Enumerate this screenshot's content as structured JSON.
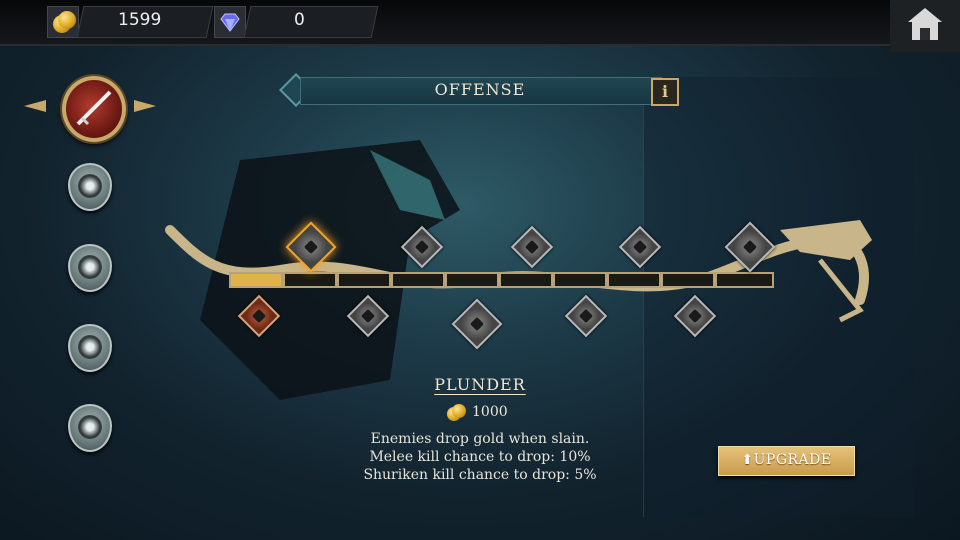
{
  "currency": {
    "gold": "1599",
    "gems": "0"
  },
  "header": {
    "title": "OFFENSE",
    "info_icon": "i"
  },
  "skill": {
    "name": "PLUNDER",
    "cost": "1000",
    "description": [
      "Enemies drop gold when slain.",
      "Melee kill chance to drop: 10%",
      "Shuriken kill chance to drop: 5%"
    ]
  },
  "actions": {
    "upgrade_label": "UPGRADE",
    "upgrade_arrow": "⬆"
  },
  "sidebar": {
    "tabs": [
      "offense",
      "shadow-dash",
      "spirit",
      "magic",
      "stealth"
    ],
    "active": "offense"
  },
  "icons": [
    "gold-coins-icon",
    "gem-icon",
    "home-icon",
    "info-icon"
  ],
  "skill_tree": {
    "progress_filled_segments": 1,
    "total_segments": 10
  },
  "colors": {
    "accent_gold": "#d9b46a",
    "selected_glow": "#f2a52a",
    "owned_node": "#c2603a"
  }
}
